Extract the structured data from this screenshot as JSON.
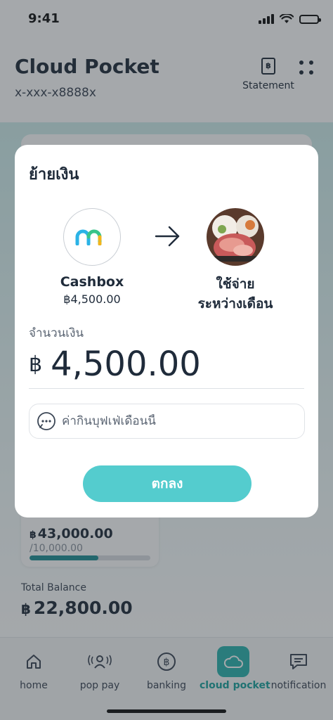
{
  "status_bar": {
    "time": "9:41"
  },
  "header": {
    "title": "Cloud Pocket",
    "account_number": "x-xxx-x8888x",
    "statement_label": "Statement",
    "statement_icon": "receipt-icon",
    "menu_icon": "grid-dots-icon"
  },
  "background": {
    "mini_card": {
      "currency": "฿",
      "amount": "43,000.00",
      "target": "/10,000.00",
      "progress_fraction": 0.57
    },
    "total": {
      "label": "Total Balance",
      "currency": "฿",
      "amount": "22,800.00"
    }
  },
  "tabbar": {
    "items": [
      {
        "label": "home",
        "icon": "house-icon"
      },
      {
        "label": "pop pay",
        "icon": "pop-pay-icon"
      },
      {
        "label": "banking",
        "icon": "baht-coin-icon"
      },
      {
        "label": "cloud pocket",
        "icon": "cloud-icon",
        "active": true
      },
      {
        "label": "notification",
        "icon": "message-icon"
      }
    ]
  },
  "modal": {
    "title": "ย้ายเงิน",
    "from": {
      "name": "Cashbox",
      "balance": "฿4,500.00",
      "logo": "cashbox-logo"
    },
    "to": {
      "name_line1": "ใช้จ่าย",
      "name_line2": "ระหว่างเดือน",
      "image": "shabu-pot-photo"
    },
    "amount_label": "จำนวนเงิน",
    "currency": "฿",
    "amount": "4,500.00",
    "note_placeholder": "ค่ากินบุฟเฟ่เดือนนี้",
    "confirm_label": "ตกลง"
  },
  "colors": {
    "accent": "#54ccce",
    "active_tab": "#2bb3ae",
    "progress": "#1f8f94",
    "text_dark": "#1f2b3a"
  }
}
